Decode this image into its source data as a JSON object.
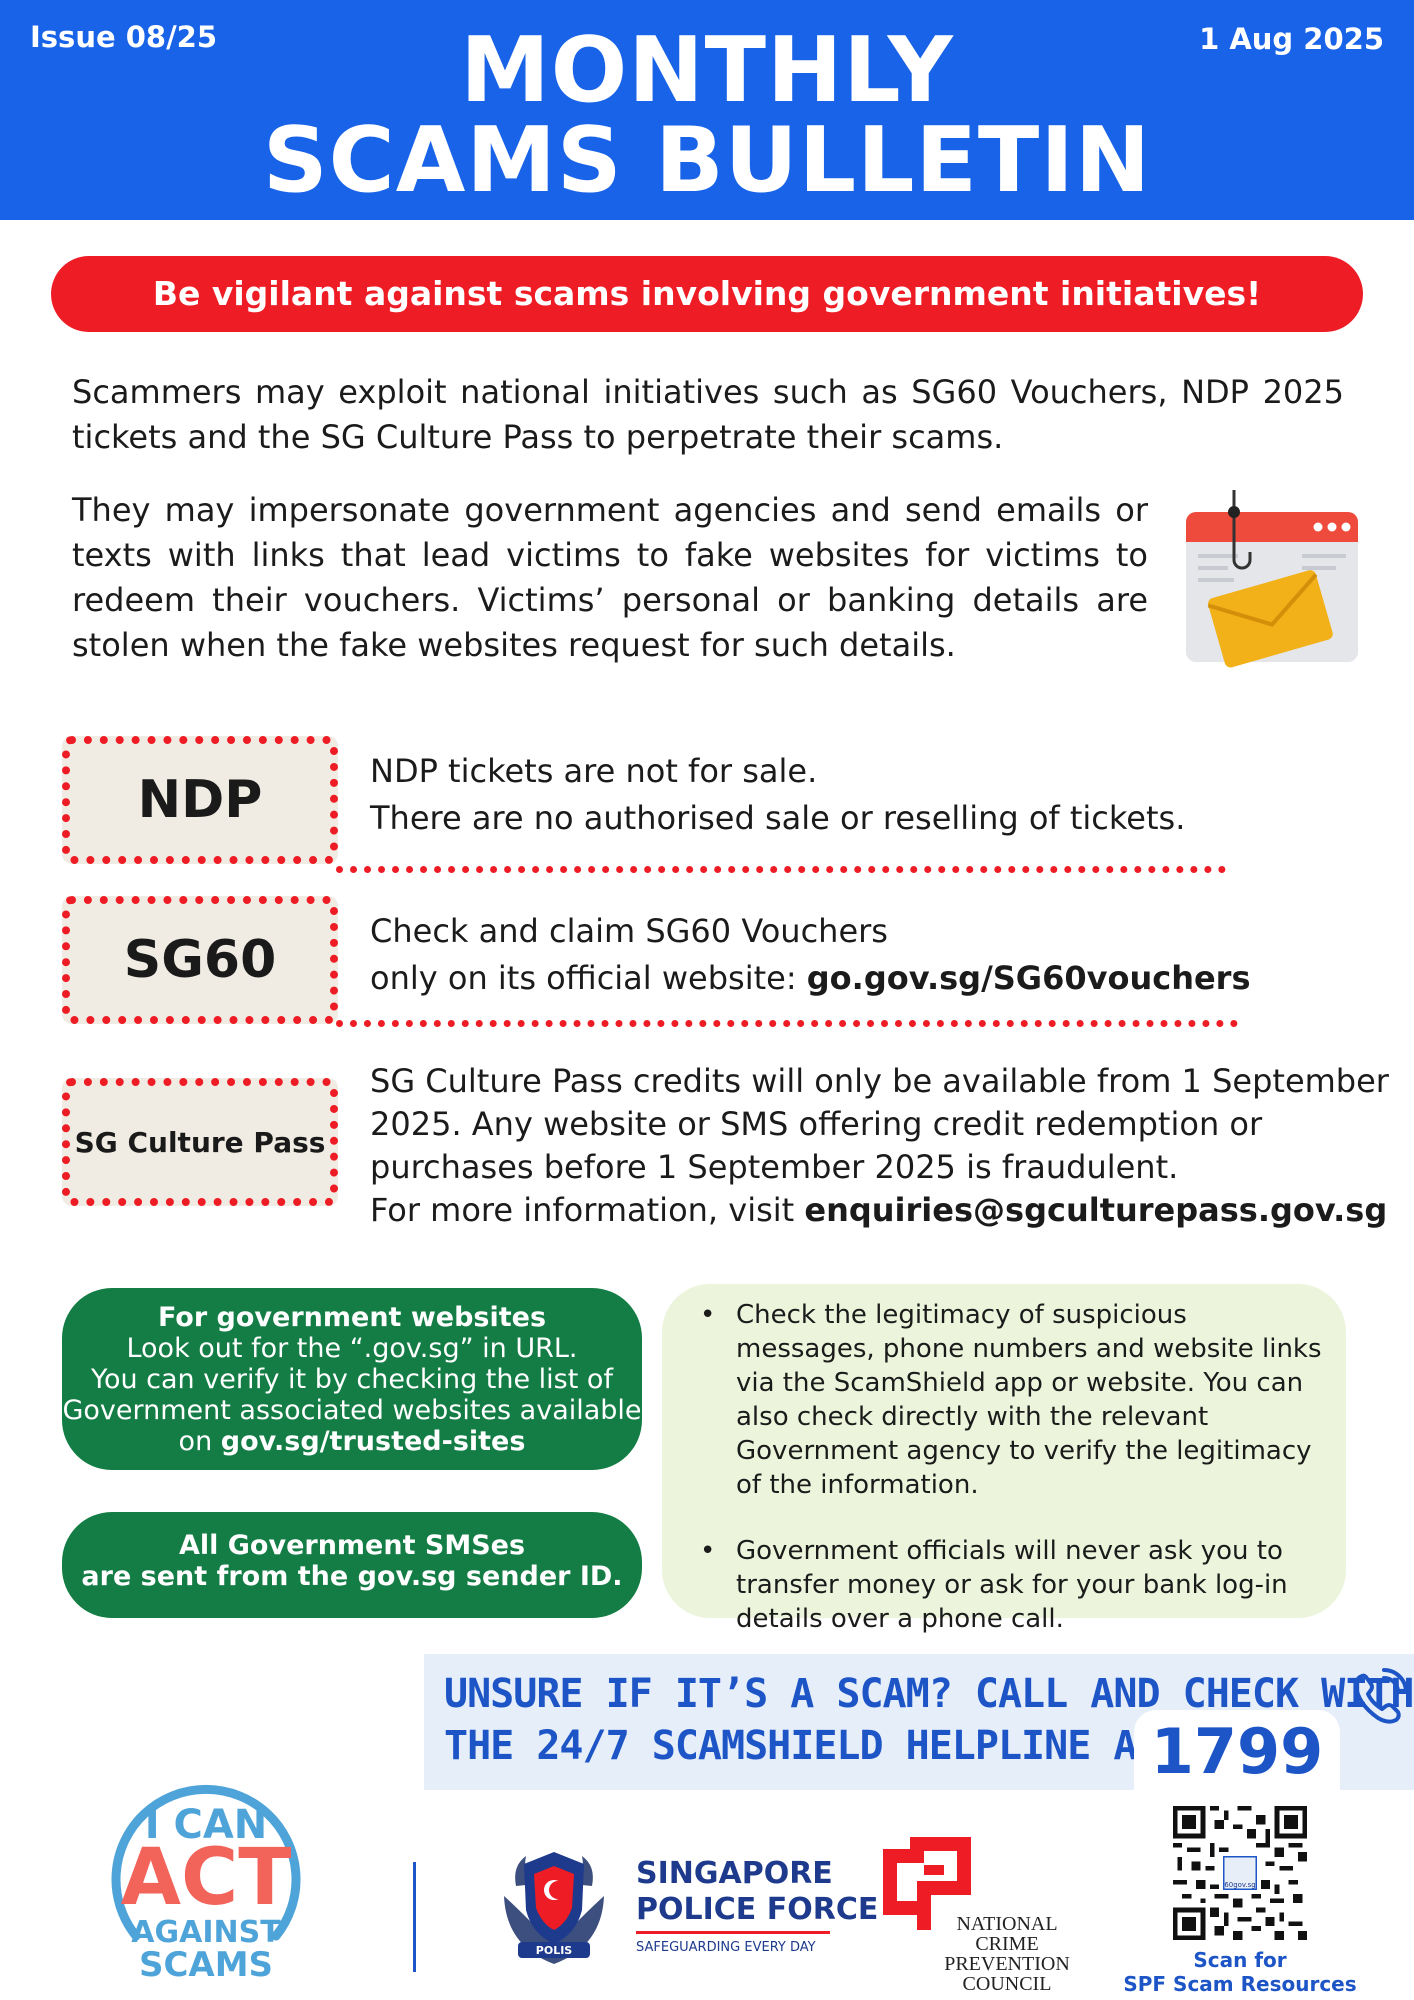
{
  "header": {
    "issue": "Issue 08/25",
    "date": "1 Aug 2025",
    "title_line1": "MONTHLY",
    "title_line2": "SCAMS BULLETIN"
  },
  "alert_banner": "Be vigilant against scams involving government initiatives!",
  "intro": {
    "paragraph1": "Scammers may exploit national initiatives such as SG60 Vouchers, NDP 2025 tickets and the SG Culture Pass to perpetrate their scams.",
    "paragraph2": "They may impersonate government agencies and send emails or texts with links that lead victims to fake websites for victims to redeem their vouchers. Victims’ personal or banking details are stolen when the fake websites request for such details."
  },
  "tickets": [
    {
      "label": "NDP",
      "line1": "NDP tickets are not for sale.",
      "line2": "There are no authorised sale or reselling of tickets."
    },
    {
      "label": "SG60",
      "line1": "Check and claim SG60 Vouchers",
      "line2_prefix": "only on its official website: ",
      "line2_link": "go.gov.sg/SG60vouchers"
    },
    {
      "label": "SG Culture Pass",
      "line1": "SG Culture Pass credits will only be available from 1 September",
      "line2": "2025. Any website or SMS offering credit redemption or",
      "line3": "purchases before 1 September 2025 is fraudulent.",
      "line4_prefix": "For more information, visit ",
      "line4_link": "enquiries@sgculturepass.gov.sg"
    }
  ],
  "gov_websites": {
    "heading": "For government websites",
    "line1": "Look out for the “.gov.sg” in URL.",
    "line2": "You can verify it by checking the list of",
    "line3": "Government associated websites available",
    "line4_prefix": "on ",
    "line4_link": "gov.sg/trusted-sites"
  },
  "gov_sms": {
    "line1": "All Government SMSes",
    "line2": "are sent from the gov.sg sender ID."
  },
  "tips": [
    "Check the legitimacy of suspicious messages, phone numbers and website links via the ScamShield app or website. You can also check directly with the relevant Government agency to verify the legitimacy of the information.",
    "Government officials will never ask you to transfer money or ask for your bank log-in details over a phone call."
  ],
  "helpline": {
    "line1": "UNSURE IF IT’S A SCAM? CALL AND CHECK WITH",
    "line2": "THE 24/7 SCAMSHIELD HELPLINE AT",
    "number": "1799"
  },
  "footer": {
    "act_logo": {
      "line1": "I CAN",
      "line2": "ACT",
      "line3": "AGAINST",
      "line4": "SCAMS"
    },
    "spf": {
      "line1": "SINGAPORE",
      "line2": "POLICE FORCE",
      "tagline": "SAFEGUARDING EVERY DAY",
      "crest_text": "POLIS"
    },
    "ncpc": {
      "line1": "NATIONAL",
      "line2": "CRIME PREVENTION",
      "line3": "COUNCIL"
    },
    "qr_caption_line1": "Scan for",
    "qr_caption_line2": "SPF Scam Resources",
    "qr_center": "60gov.sg"
  },
  "colors": {
    "header_blue": "#1863e8",
    "alert_red": "#ee1c25",
    "ticket_bg": "#f1ece3",
    "green": "#137d45",
    "tips_bg": "#ecf5dc",
    "helpline_bg": "#e6eefa",
    "helpline_text": "#1d55c7"
  },
  "icons": [
    "phishing-email-icon",
    "phone-icon",
    "spf-crest-icon",
    "ncpc-logo-icon",
    "qr-code-icon"
  ]
}
